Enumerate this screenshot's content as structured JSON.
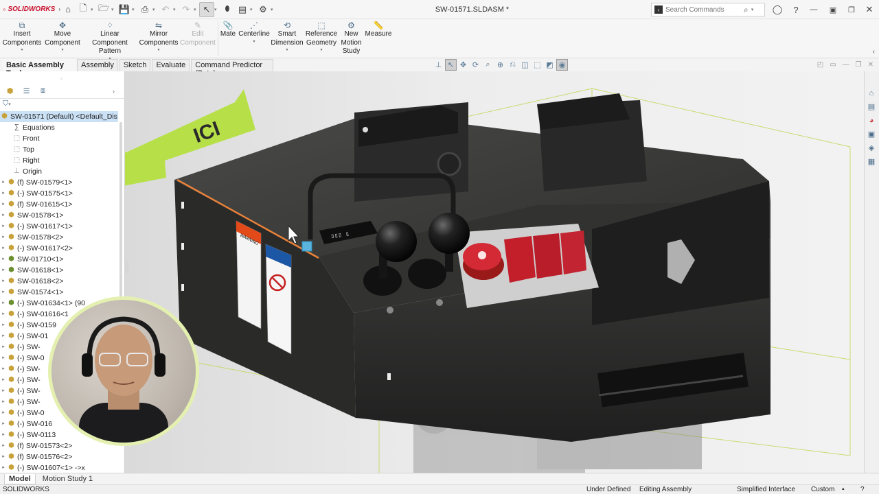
{
  "app": {
    "logo_text": "SOLIDWORKS",
    "document_title": "SW-01571.SLDASM *"
  },
  "search": {
    "placeholder": "Search Commands"
  },
  "ribbon": {
    "buttons": [
      {
        "label_1": "Insert",
        "label_2": "Components",
        "icon": "insert-components-icon",
        "disabled": false
      },
      {
        "label_1": "Move",
        "label_2": "Component",
        "icon": "move-component-icon",
        "disabled": false
      },
      {
        "label_1": "Linear Component",
        "label_2": "Pattern",
        "icon": "linear-pattern-icon",
        "disabled": false
      },
      {
        "label_1": "Mirror",
        "label_2": "Components",
        "icon": "mirror-components-icon",
        "disabled": false
      },
      {
        "label_1": "Edit",
        "label_2": "Component",
        "icon": "edit-component-icon",
        "disabled": true
      },
      {
        "label_1": "Mate",
        "label_2": "",
        "icon": "mate-icon",
        "disabled": false
      },
      {
        "label_1": "Centerline",
        "label_2": "",
        "icon": "centerline-icon",
        "disabled": false
      },
      {
        "label_1": "Smart",
        "label_2": "Dimension",
        "icon": "smart-dimension-icon",
        "disabled": false
      },
      {
        "label_1": "Reference",
        "label_2": "Geometry",
        "icon": "reference-geometry-icon",
        "disabled": false
      },
      {
        "label_1": "New",
        "label_2": "Motion",
        "label_3": "Study",
        "icon": "new-motion-study-icon",
        "disabled": false
      },
      {
        "label_1": "Measure",
        "label_2": "",
        "icon": "measure-icon",
        "disabled": false
      }
    ]
  },
  "tabs": [
    "Basic Assembly Tools",
    "Assembly",
    "Sketch",
    "Evaluate",
    "Command Predictor (Beta)"
  ],
  "annotation": {
    "arrow_text": "ICI",
    "arrow_color": "#b4e03c"
  },
  "tree": {
    "root": "SW-01571 (Default) <Default_Dis",
    "items": [
      {
        "label": "Equations",
        "type": "eq",
        "toggle": false
      },
      {
        "label": "Front",
        "type": "plane",
        "toggle": false
      },
      {
        "label": "Top",
        "type": "plane",
        "toggle": false
      },
      {
        "label": "Right",
        "type": "plane",
        "toggle": false
      },
      {
        "label": "Origin",
        "type": "origin",
        "toggle": false
      },
      {
        "label": "(f) SW-01579<1>",
        "type": "asm",
        "toggle": true
      },
      {
        "label": "(-) SW-01575<1>",
        "type": "asm",
        "toggle": true
      },
      {
        "label": "(f) SW-01615<1>",
        "type": "asm",
        "toggle": true
      },
      {
        "label": "SW-01578<1>",
        "type": "asm",
        "toggle": true
      },
      {
        "label": "(-) SW-01617<1>",
        "type": "asm",
        "toggle": true
      },
      {
        "label": "SW-01578<2>",
        "type": "asm",
        "toggle": true
      },
      {
        "label": "(-) SW-01617<2>",
        "type": "asm",
        "toggle": true
      },
      {
        "label": "SW-01710<1>",
        "type": "part",
        "toggle": true
      },
      {
        "label": "SW-01618<1>",
        "type": "part",
        "toggle": true
      },
      {
        "label": "SW-01618<2>",
        "type": "asm",
        "toggle": true
      },
      {
        "label": "SW-01574<1>",
        "type": "asm",
        "toggle": true
      },
      {
        "label": "(-) SW-01634<1> (90",
        "type": "part",
        "toggle": true
      },
      {
        "label": "(-) SW-01616<1",
        "type": "asm",
        "toggle": true
      },
      {
        "label": "(-) SW-0159",
        "type": "asm",
        "toggle": true
      },
      {
        "label": "(-) SW-01",
        "type": "asm",
        "toggle": true
      },
      {
        "label": "(-) SW-",
        "type": "asm",
        "toggle": true
      },
      {
        "label": "(-) SW-0",
        "type": "asm",
        "toggle": true
      },
      {
        "label": "(-) SW-",
        "type": "asm",
        "toggle": true
      },
      {
        "label": "(-) SW-",
        "type": "asm",
        "toggle": true
      },
      {
        "label": "(-) SW-",
        "type": "asm",
        "toggle": true
      },
      {
        "label": "(-) SW-",
        "type": "asm",
        "toggle": true
      },
      {
        "label": "(-) SW-0",
        "type": "asm",
        "toggle": true
      },
      {
        "label": "(-) SW-016",
        "type": "asm",
        "toggle": true
      },
      {
        "label": "(-) SW-0113",
        "type": "asm",
        "toggle": true
      },
      {
        "label": "(f) SW-01573<2>",
        "type": "asm",
        "toggle": true
      },
      {
        "label": "(f) SW-01576<2>",
        "type": "asm",
        "toggle": true
      },
      {
        "label": "(-) SW-01607<1> ->x",
        "type": "asm",
        "toggle": true
      }
    ]
  },
  "bottom_tabs": [
    "Model",
    "Motion Study 1"
  ],
  "status": {
    "app": "SOLIDWORKS",
    "definition": "Under Defined",
    "mode": "Editing Assembly",
    "interface": "Simplified Interface",
    "units": "Custom"
  }
}
